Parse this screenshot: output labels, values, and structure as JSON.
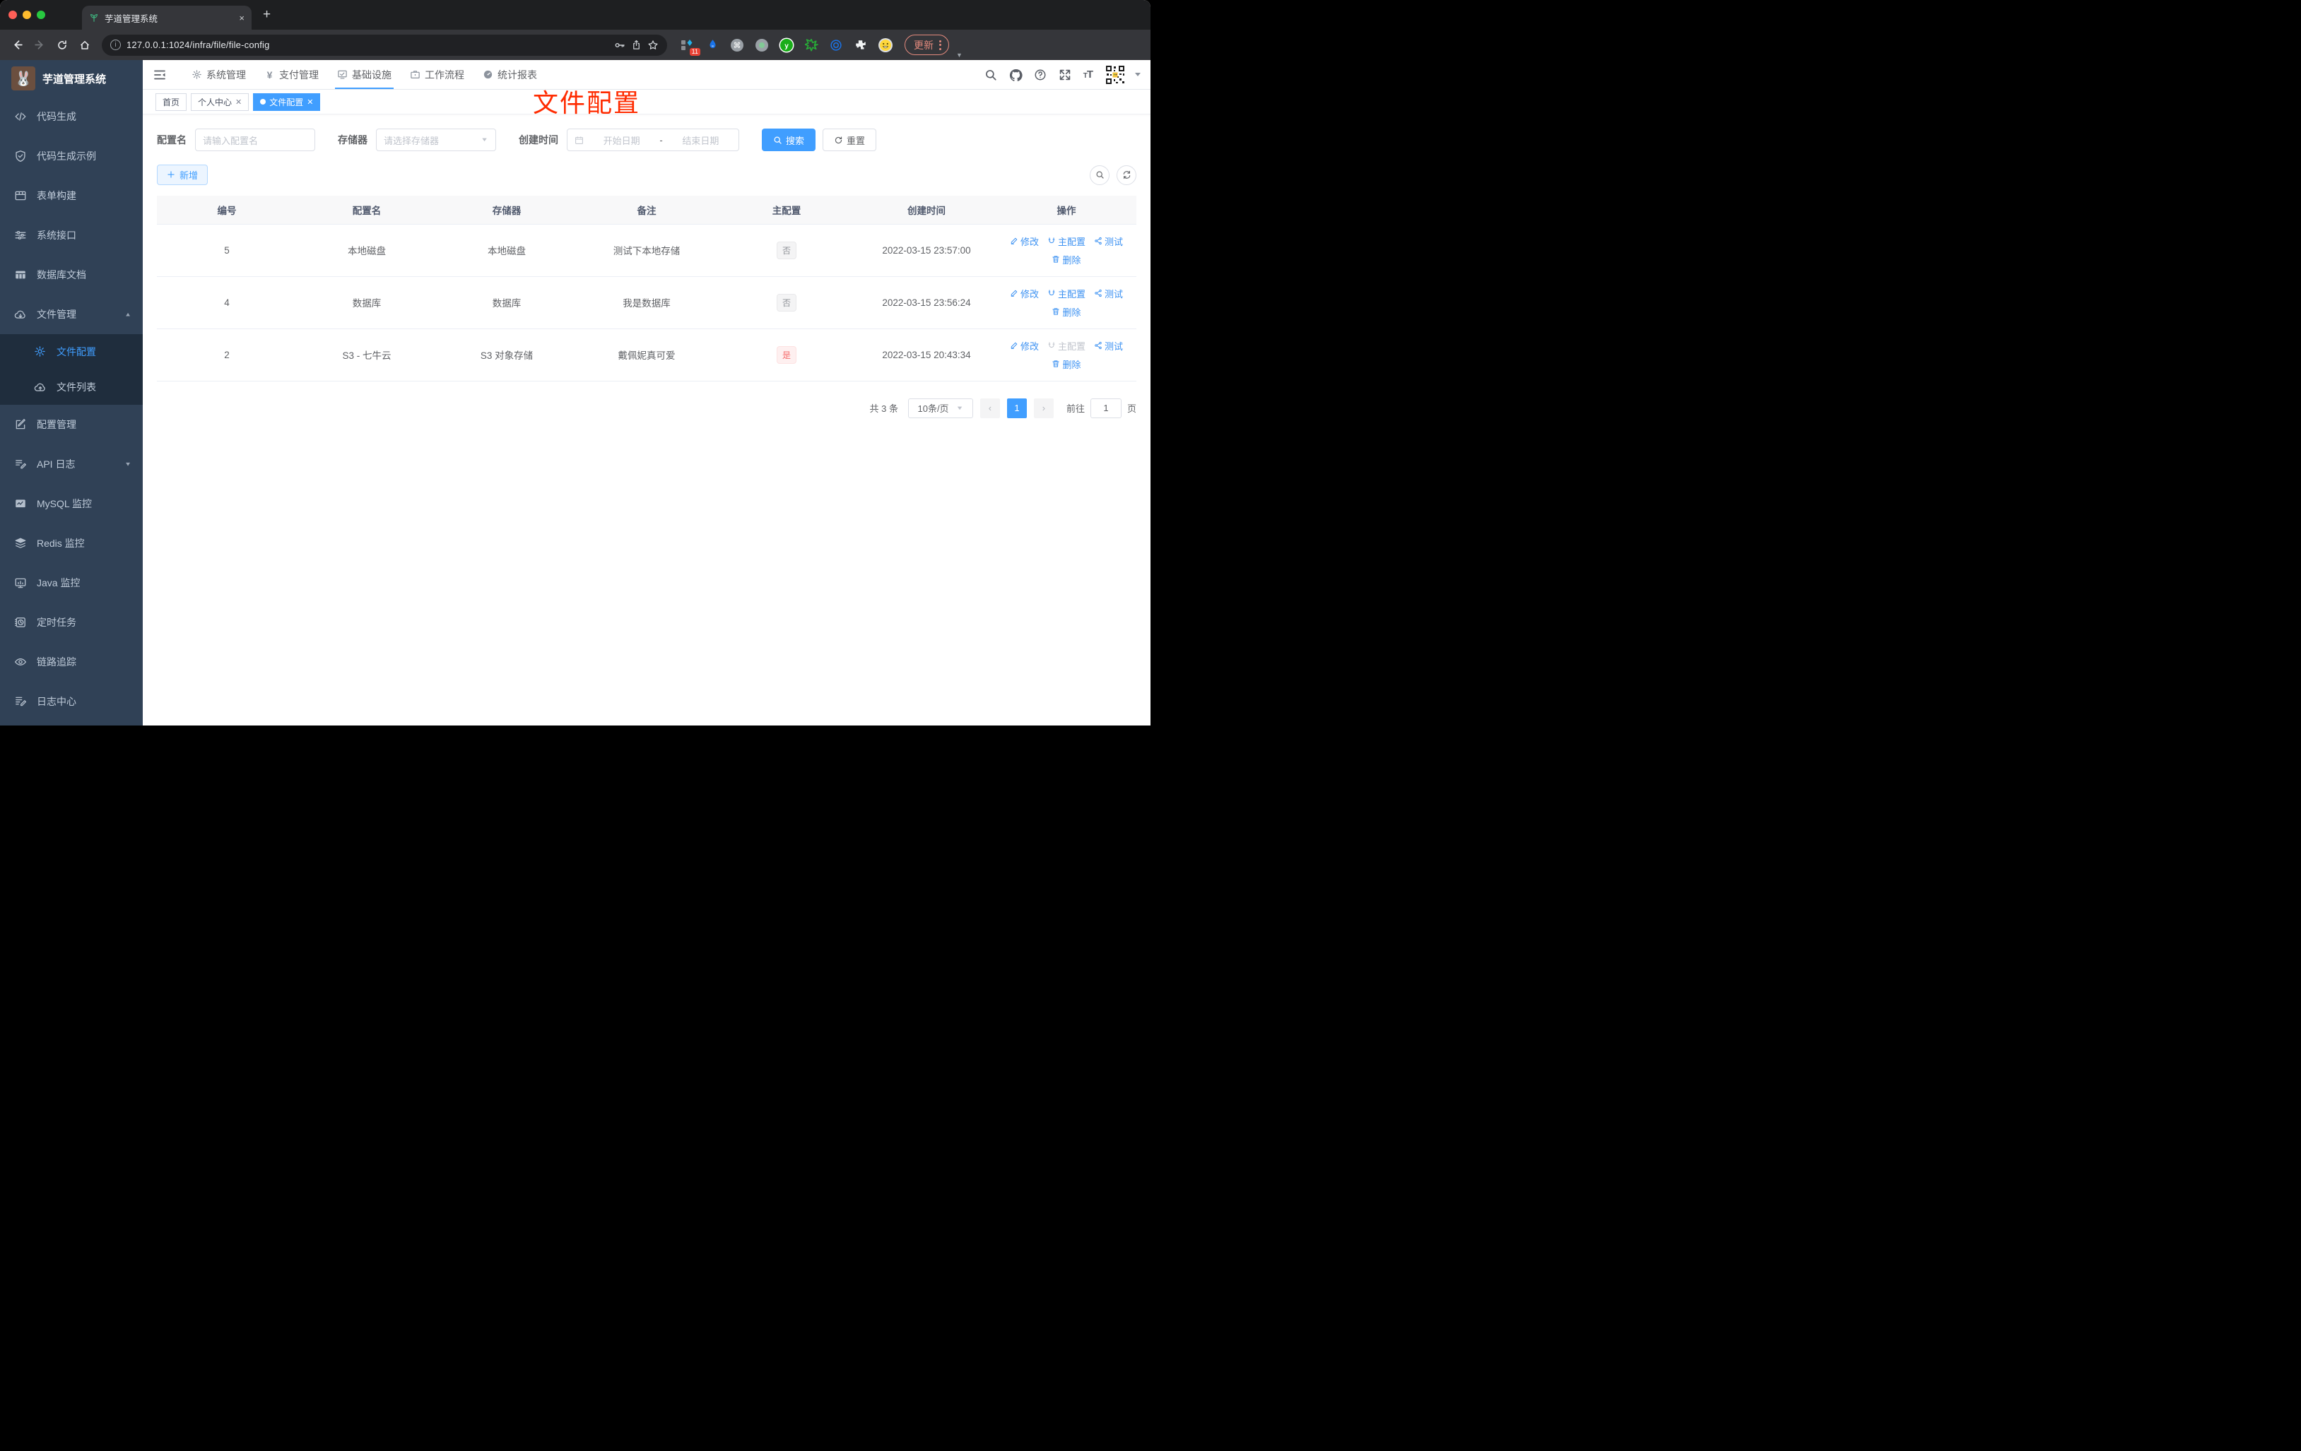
{
  "colors": {
    "accent": "#409eff",
    "danger": "#f56c6c",
    "annotation_red": "#ff2b00",
    "sidebar_bg": "#304156",
    "submenu_bg": "#1f2d3d"
  },
  "browser": {
    "tab_title": "芋道管理系统",
    "tab_close": "×",
    "new_tab": "+",
    "url": "127.0.0.1:1024/infra/file/file-config",
    "extension_badge": "11",
    "update_label": "更新"
  },
  "sidebar": {
    "logo_title": "芋道管理系统",
    "items": [
      {
        "label": "代码生成",
        "icon": "code-icon"
      },
      {
        "label": "代码生成示例",
        "icon": "shield-check-icon"
      },
      {
        "label": "表单构建",
        "icon": "form-icon"
      },
      {
        "label": "系统接口",
        "icon": "sliders-icon"
      },
      {
        "label": "数据库文档",
        "icon": "db-table-icon"
      },
      {
        "label": "文件管理",
        "icon": "cloud-download-icon",
        "expanded": true,
        "children": [
          {
            "label": "文件配置",
            "icon": "gear-icon",
            "active": true
          },
          {
            "label": "文件列表",
            "icon": "cloud-upload-icon"
          }
        ]
      },
      {
        "label": "配置管理",
        "icon": "edit-square-icon"
      },
      {
        "label": "API 日志",
        "icon": "doc-pen-icon",
        "collapsed": true
      },
      {
        "label": "MySQL 监控",
        "icon": "chart-monitor-icon"
      },
      {
        "label": "Redis 监控",
        "icon": "layers-icon"
      },
      {
        "label": "Java 监控",
        "icon": "monitor-icon"
      },
      {
        "label": "定时任务",
        "icon": "timer-icon"
      },
      {
        "label": "链路追踪",
        "icon": "eye-icon"
      },
      {
        "label": "日志中心",
        "icon": "log-edit-icon"
      }
    ]
  },
  "topnav": {
    "items": [
      {
        "label": "系统管理",
        "icon": "gear-icon"
      },
      {
        "label": "支付管理",
        "icon": "yen-icon"
      },
      {
        "label": "基础设施",
        "icon": "infra-monitor-icon",
        "active": true
      },
      {
        "label": "工作流程",
        "icon": "briefcase-icon"
      },
      {
        "label": "统计报表",
        "icon": "dashboard-icon"
      }
    ]
  },
  "tags": [
    {
      "label": "首页",
      "closable": false
    },
    {
      "label": "个人中心",
      "closable": true
    },
    {
      "label": "文件配置",
      "closable": true,
      "active": true
    }
  ],
  "annotation": {
    "text": "文件配置"
  },
  "filters": {
    "config_name": {
      "label": "配置名",
      "placeholder": "请输入配置名"
    },
    "storage": {
      "label": "存储器",
      "placeholder": "请选择存储器"
    },
    "create_time": {
      "label": "创建时间",
      "start_placeholder": "开始日期",
      "separator": "-",
      "end_placeholder": "结束日期"
    },
    "search_label": "搜索",
    "reset_label": "重置"
  },
  "toolbar": {
    "add_label": "新增"
  },
  "table": {
    "headers": [
      "编号",
      "配置名",
      "存储器",
      "备注",
      "主配置",
      "创建时间",
      "操作"
    ],
    "action_labels": {
      "edit": "修改",
      "master": "主配置",
      "test": "测试",
      "delete": "删除"
    },
    "rows": [
      {
        "id": "5",
        "name": "本地磁盘",
        "storage": "本地磁盘",
        "remark": "测试下本地存储",
        "master": "否",
        "master_type": "info",
        "created": "2022-03-15 23:57:00",
        "master_action_disabled": false
      },
      {
        "id": "4",
        "name": "数据库",
        "storage": "数据库",
        "remark": "我是数据库",
        "master": "否",
        "master_type": "info",
        "created": "2022-03-15 23:56:24",
        "master_action_disabled": false
      },
      {
        "id": "2",
        "name": "S3 - 七牛云",
        "storage": "S3 对象存储",
        "remark": "戴佩妮真可爱",
        "master": "是",
        "master_type": "danger",
        "created": "2022-03-15 20:43:34",
        "master_action_disabled": true
      }
    ]
  },
  "pagination": {
    "total": "共 3 条",
    "page_size": "10条/页",
    "prev": "‹",
    "current_page": "1",
    "next": "›",
    "goto_label": "前往",
    "goto_value": "1",
    "page_unit": "页"
  }
}
